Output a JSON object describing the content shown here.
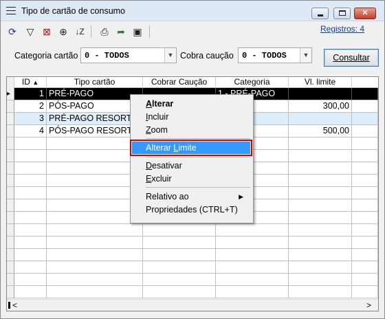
{
  "window": {
    "title": "Tipo de cartão de consumo"
  },
  "toolbar": {
    "icons": [
      "refresh-icon",
      "filter-icon",
      "clear-filter-icon",
      "find-icon",
      "sort-icon",
      "print-icon",
      "export-icon",
      "save-icon"
    ],
    "registros": "Registros: 4"
  },
  "filters": {
    "categoria_label": "Categoria cartão",
    "categoria_value": "0 - TODOS",
    "cobra_label": "Cobra caução",
    "cobra_value": "0 - TODOS",
    "consultar": "Consultar"
  },
  "grid": {
    "columns": [
      "ID",
      "Tipo cartão",
      "Cobrar Caução",
      "Categoria",
      "Vl. limite"
    ],
    "sort_indicator": "▲",
    "rows": [
      {
        "id": "1",
        "tipo": "PRÉ-PAGO",
        "caucao": "",
        "categoria": "1 - PRÉ-PAGO",
        "limite": ""
      },
      {
        "id": "2",
        "tipo": "PÓS-PAGO",
        "caucao": "",
        "categoria": "AGO",
        "limite": "300,00"
      },
      {
        "id": "3",
        "tipo": "PRÉ-PAGO RESORT",
        "caucao": "",
        "categoria": "AGO",
        "limite": ""
      },
      {
        "id": "4",
        "tipo": "PÓS-PAGO RESORT",
        "caucao": "",
        "categoria": "AGO",
        "limite": "500,00"
      }
    ]
  },
  "context_menu": {
    "items": [
      {
        "a": "A",
        "b": "lterar"
      },
      {
        "a": "I",
        "b": "ncluir"
      },
      {
        "a": "Z",
        "b": "oom"
      },
      {
        "a": "Alterar ",
        "b": "L",
        "c": "imite"
      },
      {
        "a": "D",
        "b": "esativar"
      },
      {
        "a": "E",
        "b": "xcluir"
      },
      {
        "label": "Relativo ao"
      },
      {
        "label": "Propriedades (CTRL+T)"
      }
    ]
  },
  "colors": {
    "selection_bg": "#000000",
    "highlight": "#3399ff",
    "outline": "#d40000",
    "alt_row": "#ddeefa"
  }
}
